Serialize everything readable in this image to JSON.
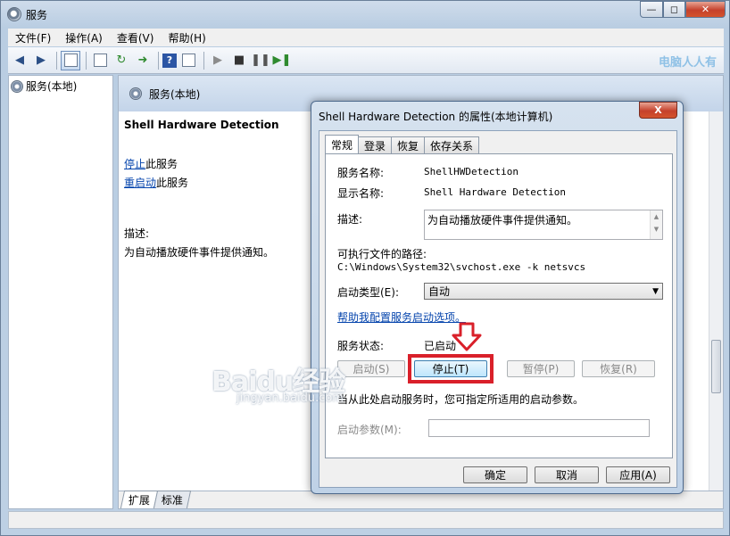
{
  "window": {
    "title": "服务"
  },
  "menu": [
    "文件(F)",
    "操作(A)",
    "查看(V)",
    "帮助(H)"
  ],
  "watermark_top": "电脑人人有",
  "tree": {
    "root": "服务(本地)"
  },
  "pane": {
    "header": "服务(本地)",
    "service_name": "Shell Hardware Detection",
    "stop_link": "停止",
    "stop_suffix": "此服务",
    "restart_link": "重启动",
    "restart_suffix": "此服务",
    "desc_label": "描述:",
    "desc_text": "为自动播放硬件事件提供通知。"
  },
  "bottom_tabs": [
    "扩展",
    "标准"
  ],
  "dialog": {
    "title": "Shell Hardware Detection 的属性(本地计算机)",
    "close": "X",
    "tabs": [
      "常规",
      "登录",
      "恢复",
      "依存关系"
    ],
    "service_name_label": "服务名称:",
    "service_name_value": "ShellHWDetection",
    "display_name_label": "显示名称:",
    "display_name_value": "Shell Hardware Detection",
    "desc_label": "描述:",
    "desc_value": "为自动播放硬件事件提供通知。",
    "exe_path_label": "可执行文件的路径:",
    "exe_path_value": "C:\\Windows\\System32\\svchost.exe -k netsvcs",
    "startup_type_label": "启动类型(E):",
    "startup_type_value": "自动",
    "help_link": "帮助我配置服务启动选项。",
    "status_label": "服务状态:",
    "status_value": "已启动",
    "buttons": {
      "start": "启动(S)",
      "stop": "停止(T)",
      "pause": "暂停(P)",
      "resume": "恢复(R)"
    },
    "hint": "当从此处启动服务时，您可指定所适用的启动参数。",
    "param_label": "启动参数(M):",
    "ok": "确定",
    "cancel": "取消",
    "apply": "应用(A)"
  },
  "watermark": {
    "logo": "Baidu经验",
    "url": "jingyan.baidu.com"
  },
  "colors": {
    "highlight": "#d9202a",
    "link": "#0645ad"
  }
}
